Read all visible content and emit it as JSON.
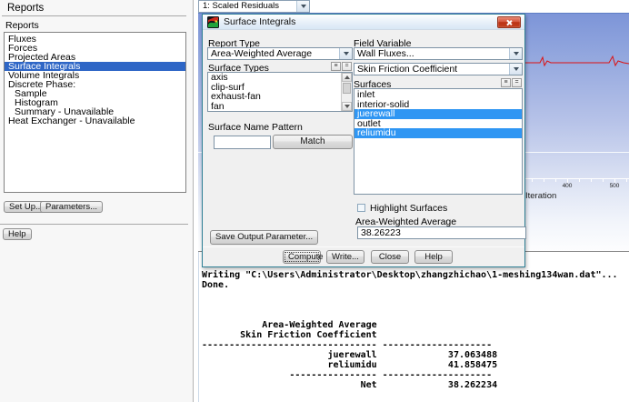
{
  "colors": {
    "left_selection": "#2e66c6",
    "surfaces_selection": "#2f96f3",
    "dialog_border": "#2e7f95",
    "residual_line": "#dd1111"
  },
  "left_panel": {
    "title": "Reports",
    "section_label": "Reports",
    "items": [
      {
        "label": "Fluxes"
      },
      {
        "label": "Forces"
      },
      {
        "label": "Projected Areas"
      },
      {
        "label": "Surface Integrals",
        "selected": true
      },
      {
        "label": "Volume Integrals"
      },
      {
        "label": "Discrete Phase:"
      },
      {
        "label": "Sample",
        "indent": true
      },
      {
        "label": "Histogram",
        "indent": true
      },
      {
        "label": "Summary - Unavailable",
        "indent": true
      },
      {
        "label": "Heat Exchanger - Unavailable"
      }
    ],
    "setup_button": "Set Up...",
    "parameters_button": "Parameters...",
    "help_button": "Help"
  },
  "toolbar": {
    "plot_selector": "1: Scaled Residuals"
  },
  "graphics": {
    "tick_400": "400",
    "tick_500": "500",
    "xlabel": "Iteration"
  },
  "dialog": {
    "title": "Surface Integrals",
    "report_type_label": "Report Type",
    "report_type_value": "Area-Weighted Average",
    "field_variable_label": "Field Variable",
    "field_variable_value": "Wall Fluxes...",
    "field_variable_sub": "Skin Friction Coefficient",
    "surface_types_label": "Surface Types",
    "surface_types": [
      "axis",
      "clip-surf",
      "exhaust-fan",
      "fan"
    ],
    "surfaces_label": "Surfaces",
    "surfaces": [
      {
        "label": "inlet"
      },
      {
        "label": "interior-solid"
      },
      {
        "label": "juerewall",
        "selected": true
      },
      {
        "label": "outlet"
      },
      {
        "label": "reliumidu",
        "selected": true
      }
    ],
    "surface_name_pattern_label": "Surface Name Pattern",
    "pattern_value": "",
    "match_button": "Match",
    "highlight_surfaces_label": "Highlight Surfaces",
    "result_label": "Area-Weighted Average",
    "result_value": "38.26223",
    "save_output_button": "Save Output Parameter...",
    "compute_button": "Compute",
    "write_button": "Write...",
    "close_button": "Close",
    "help_button": "Help"
  },
  "icons": {
    "list_lines": "≡",
    "list_equals": "="
  },
  "console": {
    "text": "Writing \"C:\\Users\\Administrator\\Desktop\\zhangzhichao\\1-meshing134wan.dat\"...\nDone.\n\n\n\n           Area-Weighted Average\n       Skin Friction Coefficient\n-------------------------------- --------------------\n                       juerewall             37.063488\n                       reliumidu             41.858475\n                ---------------- --------------------\n                             Net             38.262234"
  }
}
